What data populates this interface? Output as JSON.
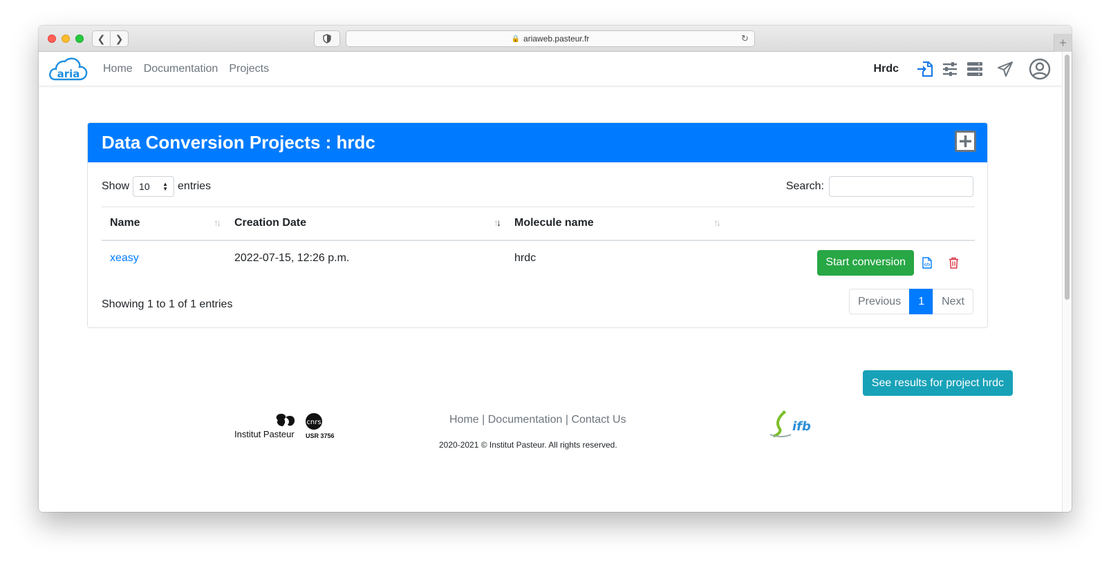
{
  "browser": {
    "url": "ariaweb.pasteur.fr"
  },
  "nav": {
    "brand": "aria",
    "links": [
      "Home",
      "Documentation",
      "Projects"
    ],
    "username": "Hrdc"
  },
  "card": {
    "title": "Data Conversion Projects : hrdc",
    "length_prefix": "Show",
    "length_value": "10",
    "length_suffix": "entries",
    "search_label": "Search:",
    "search_value": "",
    "columns": [
      "Name",
      "Creation Date",
      "Molecule name"
    ],
    "rows": [
      {
        "name": "xeasy",
        "created": "2022-07-15, 12:26 p.m.",
        "molecule": "hrdc",
        "action_label": "Start conversion"
      }
    ],
    "info": "Showing 1 to 1 of 1 entries",
    "pagination": {
      "previous": "Previous",
      "current": "1",
      "next": "Next"
    }
  },
  "results_button": "See results for project hrdc",
  "footer": {
    "pasteur_label": "Institut Pasteur",
    "cnrs_label": "cnrs",
    "usr_label": "USR 3756",
    "links": [
      "Home",
      "Documentation",
      "Contact Us"
    ],
    "separator": "|",
    "copyright": "2020-2021 © Institut Pasteur. All rights reserved.",
    "ifb_label": "ifb"
  },
  "colors": {
    "primary": "#007bff",
    "success": "#28a745",
    "info": "#17a2b8",
    "danger": "#dc3545"
  }
}
